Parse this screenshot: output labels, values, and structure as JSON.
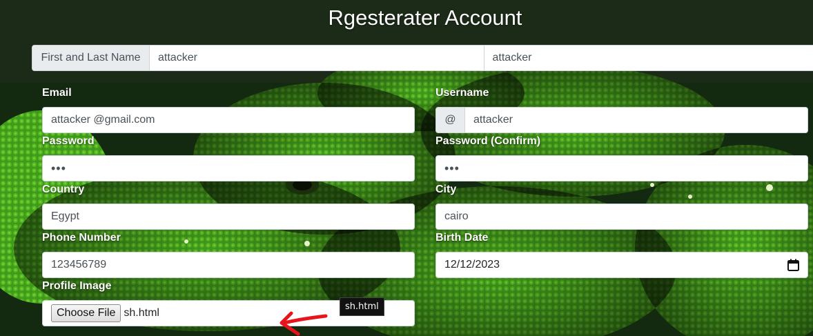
{
  "page": {
    "title": "Rgesterater Account"
  },
  "name": {
    "label": "First and Last Name",
    "first_value": "attacker",
    "last_value": "attacker"
  },
  "email": {
    "label": "Email",
    "value": "attacker @gmail.com"
  },
  "username": {
    "label": "Username",
    "prefix": "@",
    "value": "attacker"
  },
  "password": {
    "label": "Password",
    "value": "•••"
  },
  "password_confirm": {
    "label": "Password (Confirm)",
    "value": "•••"
  },
  "country": {
    "label": "Country",
    "value": "Egypt"
  },
  "city": {
    "label": "City",
    "value": "cairo"
  },
  "phone": {
    "label": "Phone Number",
    "value": "123456789"
  },
  "birth_date": {
    "label": "Birth Date",
    "value": "12/12/2023",
    "icon": "calendar-icon"
  },
  "profile_image": {
    "label": "Profile Image",
    "button_label": "Choose File",
    "file_name": "sh.html",
    "tooltip": "sh.html"
  },
  "annotation": {
    "arrow_color": "#e8141c"
  },
  "colors": {
    "label_text": "#ffffff",
    "input_border": "#ced4da",
    "addon_bg": "#e9ecef",
    "input_text": "#495057"
  }
}
